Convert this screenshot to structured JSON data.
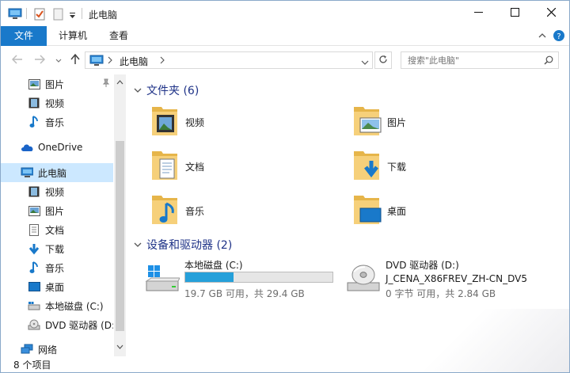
{
  "window": {
    "title": "此电脑"
  },
  "ribbon": {
    "tabs": [
      "文件",
      "计算机",
      "查看"
    ]
  },
  "address": {
    "path": "此电脑",
    "search_placeholder": "搜索\"此电脑\""
  },
  "nav": {
    "quick_access": [
      {
        "label": "图片",
        "icon": "pictures-icon"
      },
      {
        "label": "视频",
        "icon": "videos-icon"
      },
      {
        "label": "音乐",
        "icon": "music-icon"
      }
    ],
    "onedrive": "OneDrive",
    "this_pc": "此电脑",
    "pc_items": [
      {
        "label": "视频",
        "icon": "videos-icon"
      },
      {
        "label": "图片",
        "icon": "pictures-icon"
      },
      {
        "label": "文档",
        "icon": "documents-icon"
      },
      {
        "label": "下载",
        "icon": "downloads-icon"
      },
      {
        "label": "音乐",
        "icon": "music-icon"
      },
      {
        "label": "桌面",
        "icon": "desktop-icon"
      },
      {
        "label": "本地磁盘 (C:)",
        "icon": "local-disk-icon"
      },
      {
        "label": "DVD 驱动器 (D:",
        "icon": "dvd-drive-icon"
      }
    ],
    "network": "网络"
  },
  "content": {
    "folders_header": "文件夹 (6)",
    "folders": [
      {
        "label": "视频",
        "icon": "videos-folder-icon"
      },
      {
        "label": "图片",
        "icon": "pictures-folder-icon"
      },
      {
        "label": "文档",
        "icon": "documents-folder-icon"
      },
      {
        "label": "下载",
        "icon": "downloads-folder-icon"
      },
      {
        "label": "音乐",
        "icon": "music-folder-icon"
      },
      {
        "label": "桌面",
        "icon": "desktop-folder-icon"
      }
    ],
    "devices_header": "设备和驱动器 (2)",
    "drives": [
      {
        "name": "本地磁盘 (C:)",
        "usage": "19.7 GB 可用，共 29.4 GB",
        "used_fraction": 0.33
      },
      {
        "name": "DVD 驱动器 (D:)",
        "label": "J_CENA_X86FREV_ZH-CN_DV5",
        "usage": "0 字节 可用，共 2.84 GB"
      }
    ]
  },
  "status": {
    "items": "8 个项目"
  },
  "colors": {
    "accent": "#1979ca",
    "selected": "#cce8ff",
    "header_text": "#1e3287",
    "folder": "#f2c45a",
    "progress": "#26a0da"
  }
}
